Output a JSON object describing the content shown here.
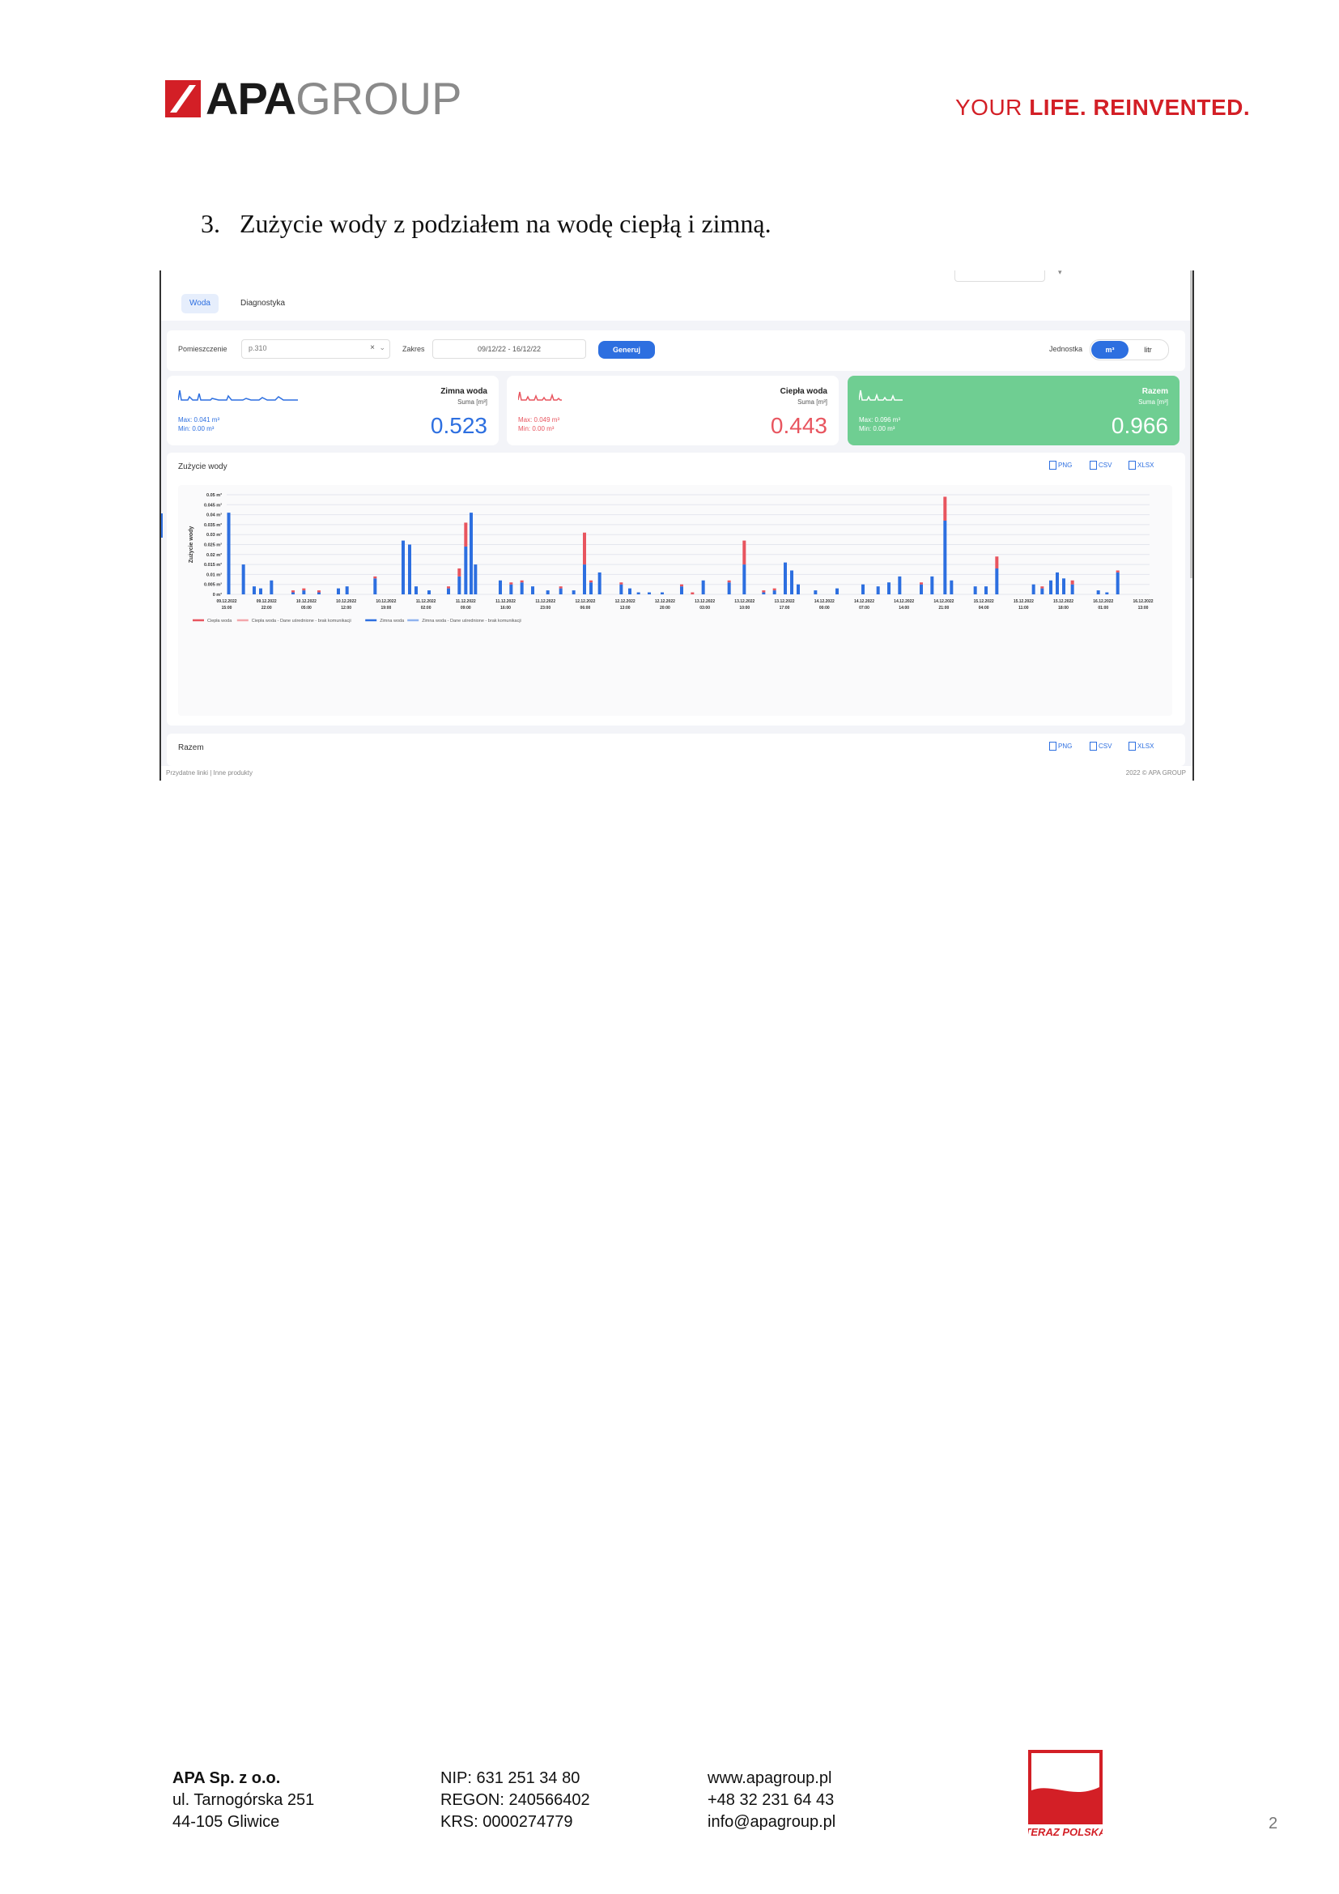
{
  "header": {
    "logo_bold": "APA",
    "logo_light": "GROUP",
    "slogan_light": "YOUR ",
    "slogan_bold": "LIFE. REINVENTED.",
    "brand_color": "#d31f26"
  },
  "heading": {
    "number": "3.",
    "text": "Zużycie wody z podziałem na wodę ciepłą i zimną."
  },
  "screenshot": {
    "tabs": [
      "Woda",
      "Diagnostyka"
    ],
    "filters": {
      "room_label": "Pomieszczenie",
      "room_value": "p.310",
      "range_label": "Zakres",
      "range_value": "09/12/22 - 16/12/22",
      "generate_label": "Generuj",
      "unit_label": "Jednostka",
      "unit_options": [
        "m³",
        "litr"
      ]
    },
    "cards": {
      "cold": {
        "title": "Zimna woda",
        "sub": "Suma [m³]",
        "max": "Max: 0.041 m³",
        "min": "Min: 0.00 m³",
        "value": "0.523"
      },
      "hot": {
        "title": "Ciepła woda",
        "sub": "Suma [m³]",
        "max": "Max: 0.049 m³",
        "min": "Min: 0.00 m³",
        "value": "0.443"
      },
      "total": {
        "title": "Razem",
        "sub": "Suma [m³]",
        "max": "Max: 0.096 m³",
        "min": "Min: 0.00 m³",
        "value": "0.966"
      }
    },
    "panel_title": "Zużycie wody",
    "export": [
      "PNG",
      "CSV",
      "XLSX"
    ],
    "panel2_title": "Razem",
    "footer_links": "Przydatne linki   |   Inne produkty",
    "footer_copy": "2022 © APA GROUP",
    "colors": {
      "cold": "#2d6fe0",
      "hot": "#e8555f",
      "total_card": "#6fce92"
    }
  },
  "chart_data": {
    "type": "bar",
    "ylabel": "Zużycie wody",
    "y_ticks": [
      "0 m³",
      "0.005 m³",
      "0.01 m³",
      "0.015 m³",
      "0.02 m³",
      "0.025 m³",
      "0.03 m³",
      "0.035 m³",
      "0.04 m³",
      "0.045 m³",
      "0.05 m³"
    ],
    "ylim": [
      0,
      0.05
    ],
    "x_labels": [
      [
        "09.12.2022",
        "15:00"
      ],
      [
        "09.12.2022",
        "22:00"
      ],
      [
        "10.12.2022",
        "05:00"
      ],
      [
        "10.12.2022",
        "12:00"
      ],
      [
        "10.12.2022",
        "19:00"
      ],
      [
        "11.12.2022",
        "02:00"
      ],
      [
        "11.12.2022",
        "09:00"
      ],
      [
        "11.12.2022",
        "16:00"
      ],
      [
        "11.12.2022",
        "23:00"
      ],
      [
        "12.12.2022",
        "06:00"
      ],
      [
        "12.12.2022",
        "13:00"
      ],
      [
        "12.12.2022",
        "20:00"
      ],
      [
        "13.12.2022",
        "03:00"
      ],
      [
        "13.12.2022",
        "10:00"
      ],
      [
        "13.12.2022",
        "17:00"
      ],
      [
        "14.12.2022",
        "00:00"
      ],
      [
        "14.12.2022",
        "07:00"
      ],
      [
        "14.12.2022",
        "14:00"
      ],
      [
        "14.12.2022",
        "21:00"
      ],
      [
        "15.12.2022",
        "04:00"
      ],
      [
        "15.12.2022",
        "11:00"
      ],
      [
        "15.12.2022",
        "18:00"
      ],
      [
        "16.12.2022",
        "01:00"
      ],
      [
        "16.12.2022",
        "13:00"
      ]
    ],
    "legend": [
      "Ciepła woda",
      "Ciepła woda - Dane uśrednione - brak komunikacji",
      "Zimna woda",
      "Zimna woda - Dane uśrednione - brak komunikacji"
    ],
    "legend_colors": [
      "#e8555f",
      "#f3a6ab",
      "#2d6fe0",
      "#8fb3ef"
    ],
    "bars": [
      [
        0.02,
        0.041,
        0
      ],
      [
        0.7,
        0.015,
        0
      ],
      [
        1.2,
        0.004,
        0
      ],
      [
        1.5,
        0.003,
        0
      ],
      [
        2.0,
        0.007,
        0
      ],
      [
        3.0,
        0.001,
        0.001
      ],
      [
        3.5,
        0.002,
        0.001
      ],
      [
        4.2,
        0.001,
        0.001
      ],
      [
        5.1,
        0.003,
        0
      ],
      [
        5.5,
        0.004,
        0
      ],
      [
        6.8,
        0.008,
        0.001
      ],
      [
        8.1,
        0.027,
        0
      ],
      [
        8.4,
        0.025,
        0
      ],
      [
        8.7,
        0.004,
        0
      ],
      [
        9.3,
        0.002,
        0
      ],
      [
        10.2,
        0.003,
        0.001
      ],
      [
        10.7,
        0.009,
        0.004
      ],
      [
        11.0,
        0.024,
        0.012
      ],
      [
        11.25,
        0.041,
        0
      ],
      [
        11.45,
        0.015,
        0
      ],
      [
        12.6,
        0.007,
        0
      ],
      [
        13.1,
        0.005,
        0.001
      ],
      [
        13.6,
        0.006,
        0.001
      ],
      [
        14.1,
        0.004,
        0
      ],
      [
        14.8,
        0.002,
        0
      ],
      [
        15.4,
        0.003,
        0.001
      ],
      [
        16.0,
        0.002,
        0
      ],
      [
        16.5,
        0.015,
        0.016
      ],
      [
        16.8,
        0.006,
        0.001
      ],
      [
        17.2,
        0.011,
        0
      ],
      [
        18.2,
        0.005,
        0.001
      ],
      [
        18.6,
        0.003,
        0
      ],
      [
        19.0,
        0.001,
        0
      ],
      [
        19.5,
        0.001,
        0
      ],
      [
        20.1,
        0.001,
        0
      ],
      [
        21.0,
        0.004,
        0.001
      ],
      [
        21.5,
        0.0,
        0.001
      ],
      [
        22.0,
        0.007,
        0
      ],
      [
        23.2,
        0.006,
        0.001
      ],
      [
        23.9,
        0.015,
        0.012
      ],
      [
        24.8,
        0.001,
        0.001
      ],
      [
        25.3,
        0.002,
        0.001
      ],
      [
        25.8,
        0.016,
        0
      ],
      [
        26.1,
        0.012,
        0
      ],
      [
        26.4,
        0.005,
        0
      ],
      [
        27.2,
        0.002,
        0
      ],
      [
        28.2,
        0.003,
        0
      ],
      [
        29.4,
        0.005,
        0
      ],
      [
        30.1,
        0.004,
        0
      ],
      [
        30.6,
        0.006,
        0
      ],
      [
        31.1,
        0.009,
        0
      ],
      [
        32.1,
        0.005,
        0.001
      ],
      [
        32.6,
        0.009,
        0
      ],
      [
        33.2,
        0.037,
        0.012
      ],
      [
        33.5,
        0.007,
        0
      ],
      [
        34.6,
        0.004,
        0
      ],
      [
        35.1,
        0.004,
        0
      ],
      [
        35.6,
        0.013,
        0.006
      ],
      [
        37.3,
        0.005,
        0
      ],
      [
        37.7,
        0.003,
        0.001
      ],
      [
        38.1,
        0.007,
        0
      ],
      [
        38.4,
        0.011,
        0
      ],
      [
        38.7,
        0.008,
        0
      ],
      [
        39.1,
        0.005,
        0.002
      ],
      [
        40.3,
        0.002,
        0
      ],
      [
        40.7,
        0.001,
        0
      ],
      [
        41.2,
        0.011,
        0.001
      ]
    ]
  },
  "footer": {
    "col1": [
      "APA Sp. z o.o.",
      "ul. Tarnogórska 251",
      "44-105 Gliwice"
    ],
    "col2": [
      "NIP: 631 251 34 80",
      "REGON: 240566402",
      "KRS: 0000274779"
    ],
    "col3": [
      "www.apagroup.pl",
      "+48 32 231 64 43",
      "info@apagroup.pl"
    ],
    "badge_text": "TERAZ POLSKA",
    "page_number": "2"
  }
}
